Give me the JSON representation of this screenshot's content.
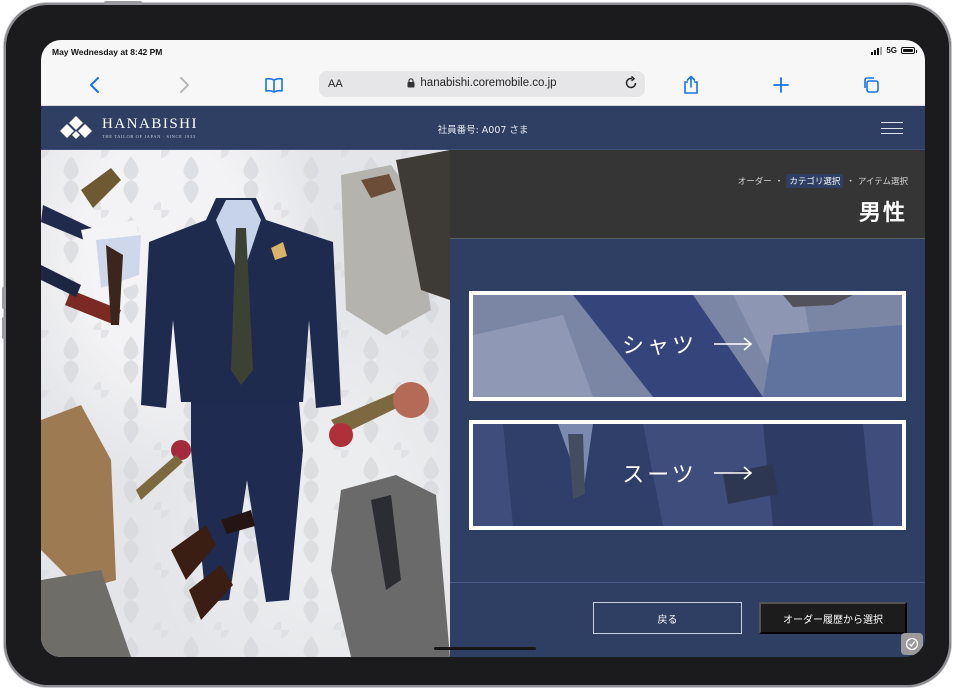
{
  "status_bar": {
    "time": "May Wednesday at 8:42 PM",
    "network": "5G"
  },
  "browser": {
    "text_size_label": "AA",
    "url": "hanabishi.coremobile.co.jp"
  },
  "site_header": {
    "brand": "HANABISHI",
    "tagline": "THE TAILOR OF JAPAN · SINCE 1933",
    "employee_label": "社員番号: A007 さま"
  },
  "breadcrumb": {
    "step1": "オーダー",
    "sep1": "・",
    "step2": "カテゴリ選択",
    "sep2": "・",
    "step3": "アイテム選択"
  },
  "page_title": "男性",
  "categories": [
    {
      "label": "シャツ",
      "arrow": "→"
    },
    {
      "label": "スーツ",
      "arrow": "→"
    }
  ],
  "footer": {
    "back_label": "戻る",
    "history_label": "オーダー履歴から選択"
  },
  "colors": {
    "navy": "#2f3e63",
    "title_band": "#353535",
    "dark_button": "#1c1c1c"
  }
}
